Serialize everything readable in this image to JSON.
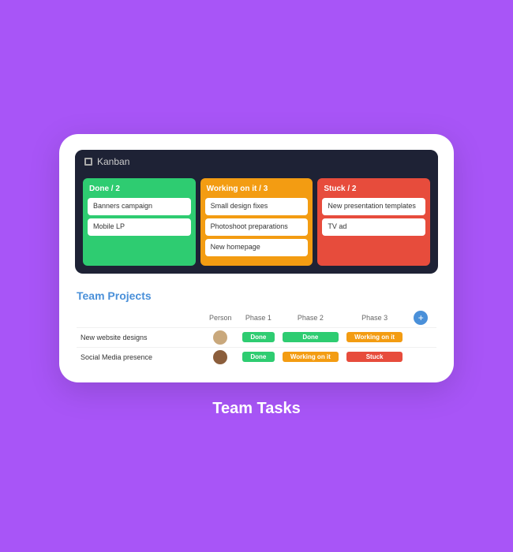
{
  "card": {
    "kanban": {
      "header_icon": "grid",
      "title": "Kanban",
      "columns": [
        {
          "id": "done",
          "label": "Done / 2",
          "color_class": "col-done",
          "cards": [
            {
              "text": "Banners campaign"
            },
            {
              "text": "Mobile LP"
            }
          ]
        },
        {
          "id": "working",
          "label": "Working on it / 3",
          "color_class": "col-working",
          "cards": [
            {
              "text": "Small design fixes"
            },
            {
              "text": "Photoshoot preparations"
            },
            {
              "text": "New homepage"
            }
          ]
        },
        {
          "id": "stuck",
          "label": "Stuck / 2",
          "color_class": "col-stuck",
          "cards": [
            {
              "text": "New presentation templates"
            },
            {
              "text": "TV ad"
            }
          ]
        }
      ]
    },
    "team_projects": {
      "title": "Team Projects",
      "columns": [
        "Person",
        "Phase 1",
        "Phase 2",
        "Phase 3"
      ],
      "add_button": "+",
      "rows": [
        {
          "name": "New website designs",
          "avatar_class": "avatar",
          "phases": [
            "Done",
            "Done",
            "Working on it"
          ],
          "phase_classes": [
            "badge-done",
            "badge-done",
            "badge-working"
          ]
        },
        {
          "name": "Social Media presence",
          "avatar_class": "avatar dark",
          "phases": [
            "Done",
            "Working on it",
            "Stuck"
          ],
          "phase_classes": [
            "badge-done",
            "badge-working",
            "badge-stuck"
          ]
        }
      ]
    }
  },
  "bottom_label": "Team Tasks"
}
